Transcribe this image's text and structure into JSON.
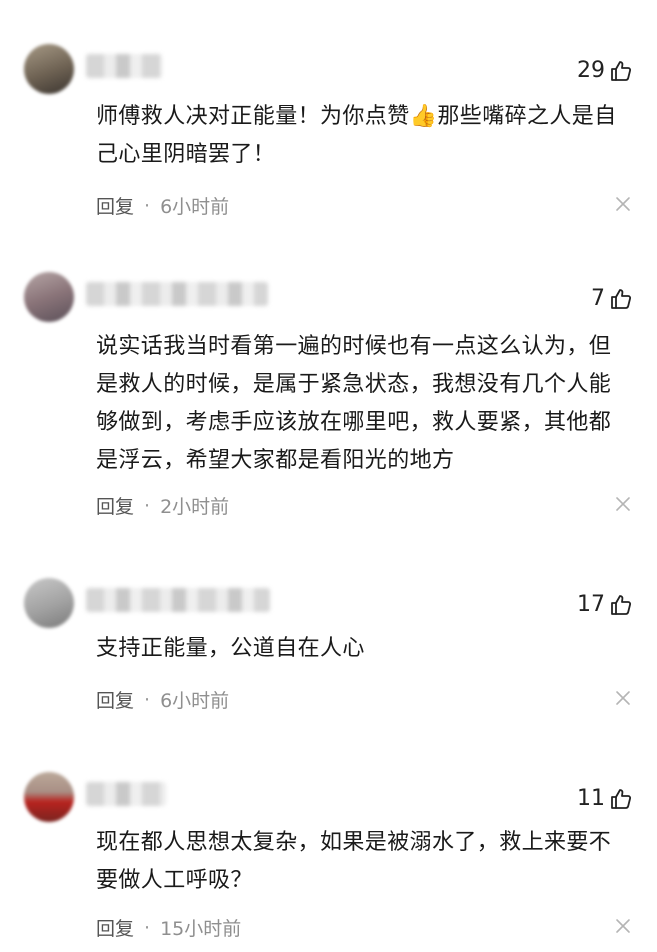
{
  "comments": [
    {
      "likes": "29",
      "text": "师傅救人决对正能量！为你点赞👍那些嘴碎之人是自己心里阴暗罢了！",
      "reply_label": "回复",
      "separator": "·",
      "time": "6小时前"
    },
    {
      "likes": "7",
      "text": "说实话我当时看第一遍的时候也有一点这么认为，但是救人的时候，是属于紧急状态，我想没有几个人能够做到，考虑手应该放在哪里吧，救人要紧，其他都是浮云，希望大家都是看阳光的地方",
      "reply_label": "回复",
      "separator": "·",
      "time": "2小时前"
    },
    {
      "likes": "17",
      "text": "支持正能量，公道自在人心",
      "reply_label": "回复",
      "separator": "·",
      "time": "6小时前"
    },
    {
      "likes": "11",
      "text": "现在都人思想太复杂，如果是被溺水了，救上来要不要做人工呼吸？",
      "reply_label": "回复",
      "separator": "·",
      "time": "15小时前"
    }
  ],
  "icons": {
    "like": "thumbs-up-outline-icon",
    "dismiss": "close-icon"
  },
  "colors": {
    "text": "#1a1a1a",
    "meta": "#8f8f8f",
    "background": "#ffffff"
  }
}
